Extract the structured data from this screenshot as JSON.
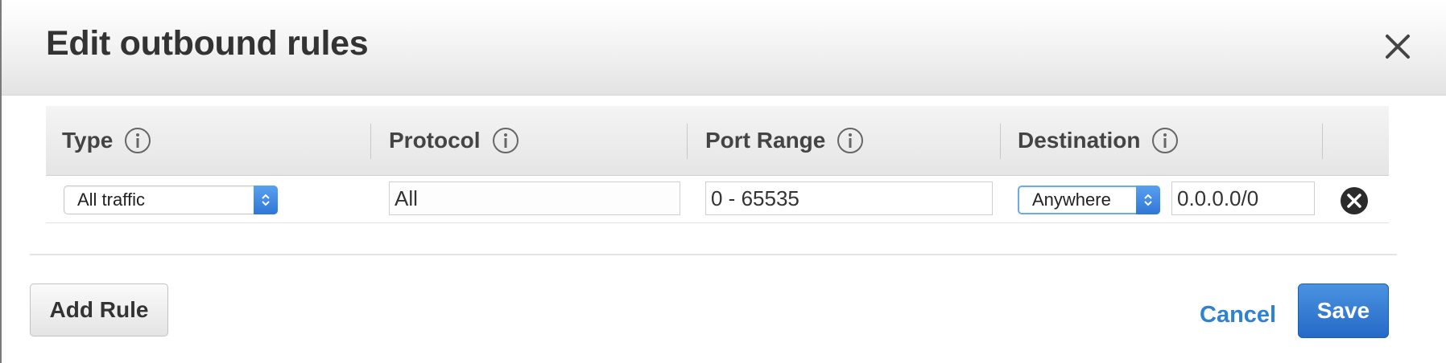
{
  "dialog": {
    "title": "Edit outbound rules",
    "close_icon": "close-icon"
  },
  "table": {
    "columns": [
      {
        "label": "Type",
        "icon": "info-icon"
      },
      {
        "label": "Protocol",
        "icon": "info-icon"
      },
      {
        "label": "Port Range",
        "icon": "info-icon"
      },
      {
        "label": "Destination",
        "icon": "info-icon"
      }
    ],
    "rows": [
      {
        "type": "All traffic",
        "protocol": "All",
        "port_range": "0 - 65535",
        "destination_type": "Anywhere",
        "destination_cidr": "0.0.0.0/0",
        "remove_icon": "remove-circle-icon"
      }
    ]
  },
  "footer": {
    "add_rule_label": "Add Rule",
    "cancel_label": "Cancel",
    "save_label": "Save"
  },
  "colors": {
    "primary": "#2f77d6",
    "link": "#2d82d2"
  }
}
